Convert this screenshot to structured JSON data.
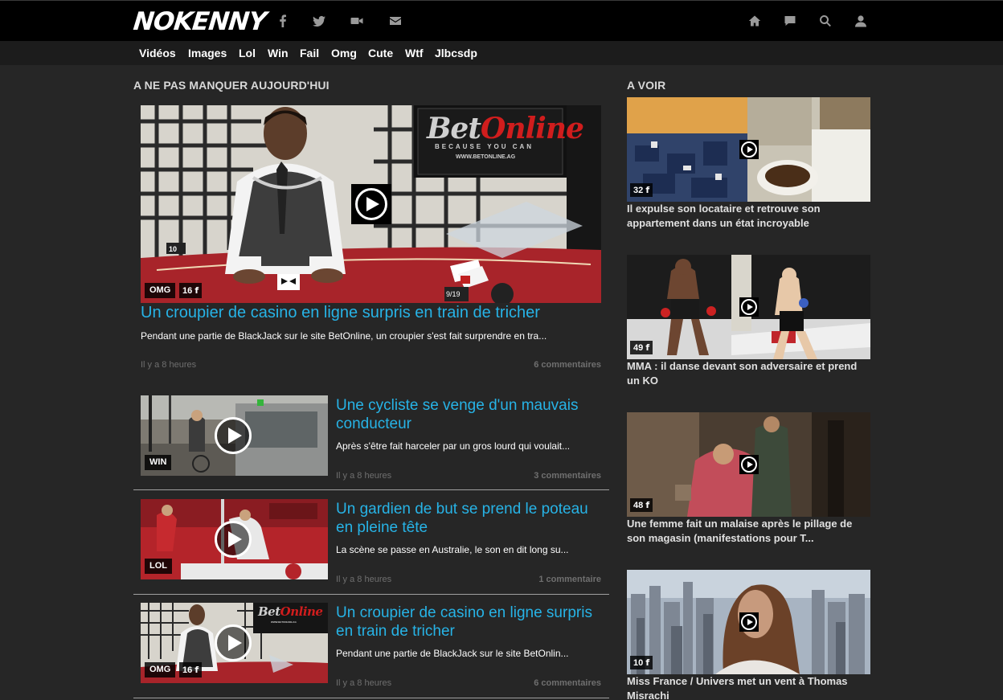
{
  "site": {
    "logo": "NOKENNY"
  },
  "social_icons": [
    "facebook-icon",
    "twitter-icon",
    "video-camera-icon",
    "envelope-icon"
  ],
  "nav_icons": [
    "home-icon",
    "chat-bubble-icon",
    "search-icon",
    "user-icon"
  ],
  "categories": [
    "Vidéos",
    "Images",
    "Lol",
    "Win",
    "Fail",
    "Omg",
    "Cute",
    "Wtf",
    "Jlbcsdp"
  ],
  "main": {
    "section_title": "A NE PAS MANQUER AUJOURD'HUI",
    "featured": {
      "tag": "OMG",
      "shares": "16",
      "title": "Un croupier de casino en ligne surpris en train de tricher",
      "excerpt": "Pendant une partie de BlackJack sur le site BetOnline, un croupier s'est fait surprendre en tra...",
      "time": "Il y a 8 heures",
      "comments": "6 commentaires",
      "thumb_text": {
        "brand1": "Bet",
        "brand2": "Online",
        "slogan": "BECAUSE YOU CAN",
        "url": "WWW.BETONLINE.AG",
        "box": "10",
        "card": "9/19"
      }
    },
    "articles": [
      {
        "tag": "WIN",
        "shares": "",
        "title_l1": "Une cycliste se venge d'un mauvais",
        "title_l2": "conducteur",
        "excerpt": "Après s'être fait harceler par un gros lourd qui voulait...",
        "time": "Il y a 8 heures",
        "comments": "3 commentaires"
      },
      {
        "tag": "LOL",
        "shares": "",
        "title_l1": "Un gardien de but se prend le poteau",
        "title_l2": "en pleine tête",
        "excerpt": "La scène se passe en Australie, le son en dit long su...",
        "time": "Il y a 8 heures",
        "comments": "1 commentaire"
      },
      {
        "tag": "OMG",
        "shares": "16",
        "title_l1": "Un croupier de casino en ligne surpris",
        "title_l2": "en train de tricher",
        "excerpt": "Pendant une partie de BlackJack sur le site BetOnlin...",
        "time": "Il y a 8 heures",
        "comments": "6 commentaires"
      }
    ]
  },
  "sidebar": {
    "section_title": "A VOIR",
    "items": [
      {
        "count": "32",
        "title": "Il expulse son locataire et retrouve son appartement dans un état incroyable"
      },
      {
        "count": "49",
        "title": "MMA : il danse devant son adversaire et prend un KO"
      },
      {
        "count": "48",
        "title": "Une femme fait un malaise après le pillage de son magasin (manifestations pour T..."
      },
      {
        "count": "10",
        "title": "Miss France / Univers met un vent à Thomas Misrachi"
      }
    ]
  },
  "colors": {
    "accent": "#27b3e6",
    "background": "#262626",
    "topbar": "#000000",
    "category_bar": "#1c1c1c"
  }
}
